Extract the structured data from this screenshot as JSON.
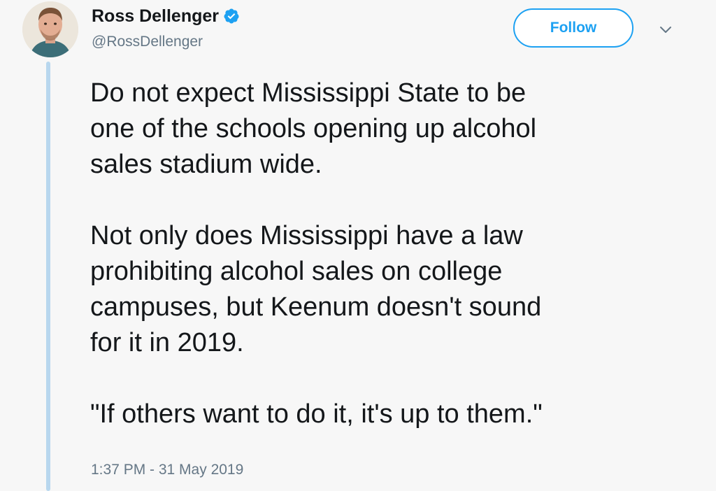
{
  "author": {
    "name": "Ross Dellenger",
    "handle": "@RossDellenger",
    "verified_icon": "verified-badge-icon",
    "avatar_icon": "avatar-photo"
  },
  "actions": {
    "follow_label": "Follow",
    "menu_icon": "chevron-down-icon"
  },
  "tweet": {
    "paragraphs": [
      [
        "Do not expect Mississippi State to be",
        "one of the schools opening up alcohol",
        "sales stadium wide."
      ],
      [
        "Not only does Mississippi have a law",
        "prohibiting alcohol sales on college",
        "campuses, but Keenum doesn't sound",
        "for it in 2019."
      ],
      [
        "\"If others want to do it, it's up to them.\""
      ]
    ],
    "timestamp": "1:37 PM - 31 May 2019"
  },
  "colors": {
    "accent": "#1da1f2",
    "text": "#14171a",
    "secondary": "#657786",
    "thread_line": "#b8d7ee"
  }
}
